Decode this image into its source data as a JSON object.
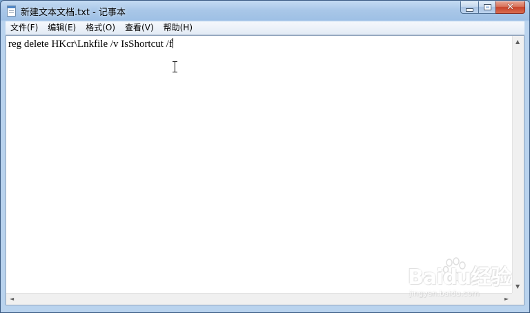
{
  "window": {
    "title": "新建文本文档.txt - 记事本",
    "icon": "notepad-icon"
  },
  "caption_buttons": {
    "minimize": "minimize-icon",
    "maximize": "maximize-icon",
    "close": "close-icon",
    "close_glyph": "✕"
  },
  "menu": {
    "file": "文件(F)",
    "edit": "编辑(E)",
    "format": "格式(O)",
    "view": "查看(V)",
    "help": "帮助(H)"
  },
  "editor": {
    "text": "reg delete HKcr\\Lnkfile /v IsShortcut /f"
  },
  "scrollbars": {
    "up_arrow": "▲",
    "down_arrow": "▼",
    "left_arrow": "◄",
    "right_arrow": "►"
  },
  "watermark": {
    "brand": "Baidu经验",
    "url": "jingyan.baidu.com"
  },
  "colors": {
    "titlebar": "#a9c7e8",
    "close_button": "#c7432b",
    "editor_background": "#ffffff"
  }
}
